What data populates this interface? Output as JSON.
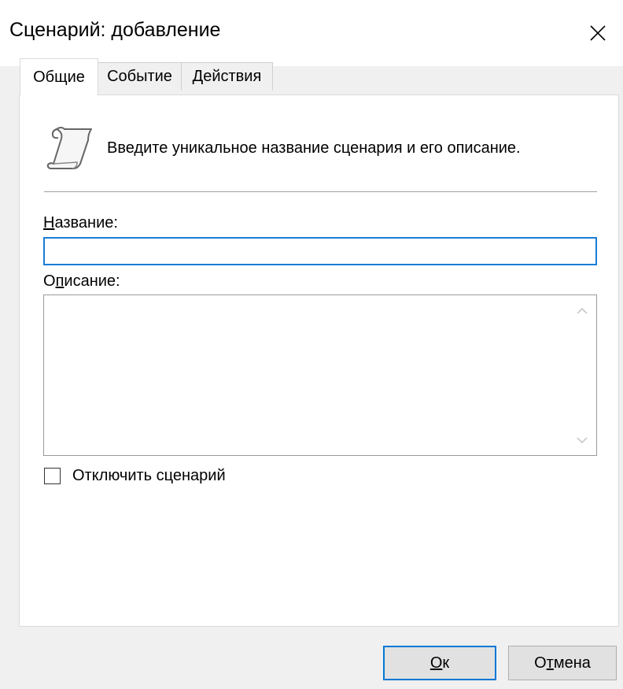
{
  "window": {
    "title": "Сценарий: добавление"
  },
  "tabs": [
    {
      "label": "Общие",
      "active": true
    },
    {
      "label": "Событие",
      "active": false
    },
    {
      "label": "Действия",
      "active": false
    }
  ],
  "general": {
    "intro_text": "Введите уникальное название сценария и его описание.",
    "name_label_accel": "Н",
    "name_label_rest": "азвание:",
    "name_value": "",
    "desc_label_first": "О",
    "desc_label_accel": "п",
    "desc_label_rest": "исание:",
    "desc_value": "",
    "disable_label": "Отключить сценарий",
    "disable_checked": false
  },
  "buttons": {
    "ok_accel": "О",
    "ok_rest": "к",
    "cancel_first": "О",
    "cancel_accel": "т",
    "cancel_rest": "мена"
  },
  "icons": {
    "close": "close-icon",
    "header": "scroll-icon",
    "scroll_up": "chevron-up-icon",
    "scroll_down": "chevron-down-icon"
  },
  "colors": {
    "focus_border": "#1a7dd7",
    "default_button_border": "#0078d7",
    "panel_bg": "#ffffff",
    "window_bg": "#f0f0f0"
  }
}
